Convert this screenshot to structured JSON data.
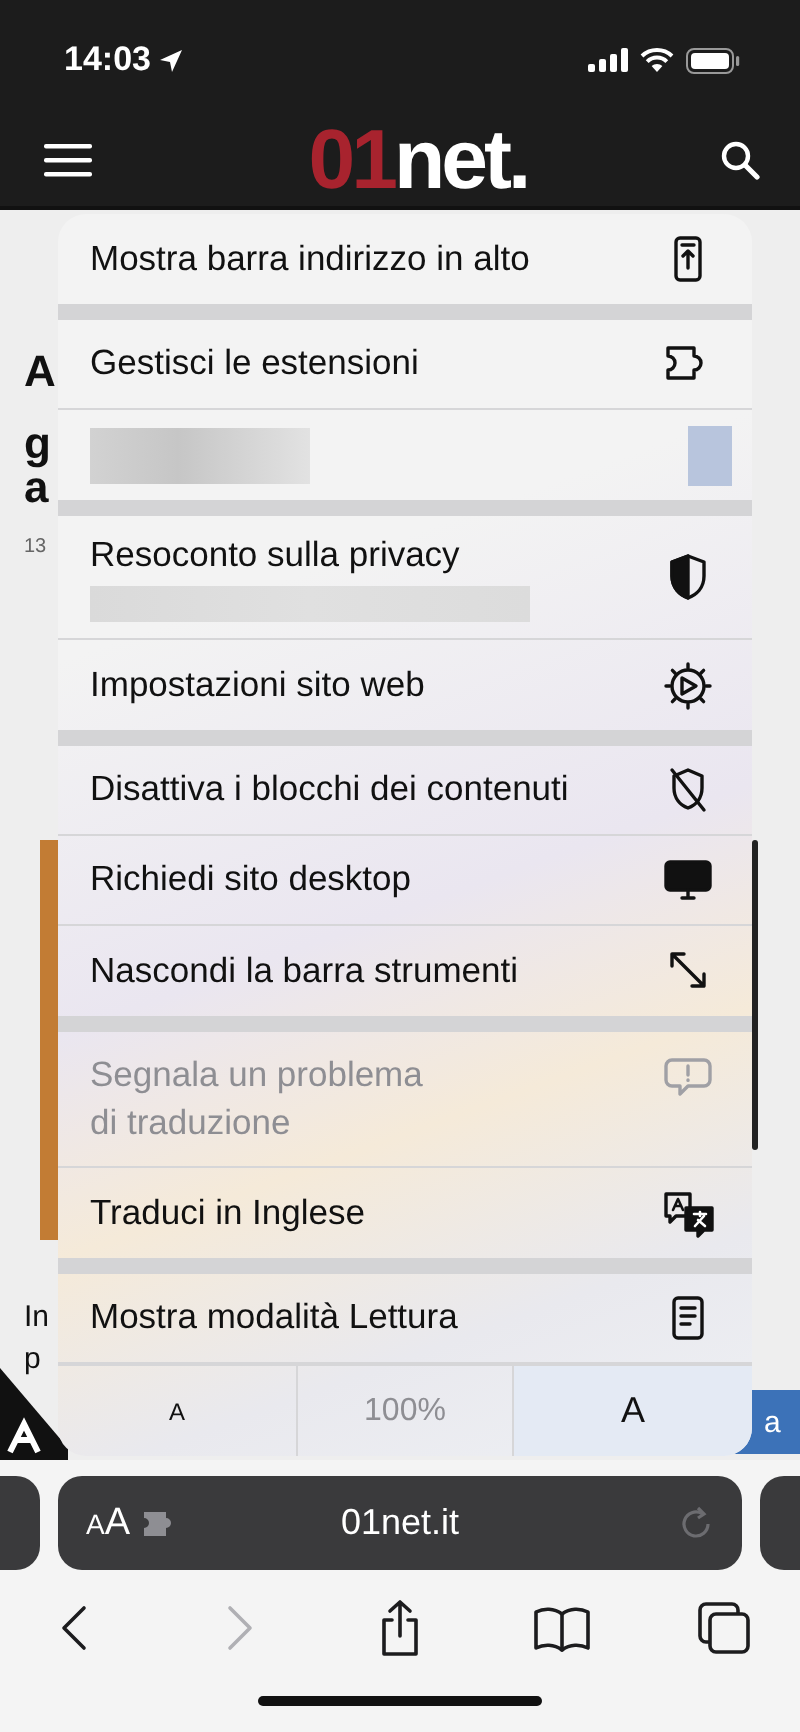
{
  "status_bar": {
    "time": "14:03"
  },
  "header": {
    "logo_red": "01",
    "logo_white": "net."
  },
  "page_behind": {
    "fragments": [
      {
        "kind": "heading",
        "text": "A"
      },
      {
        "kind": "heading",
        "text": "g"
      },
      {
        "kind": "heading",
        "text": "a"
      },
      {
        "kind": "small",
        "text": "13"
      },
      {
        "kind": "body",
        "text": "In"
      },
      {
        "kind": "body",
        "text": "p"
      }
    ],
    "button_text": "a"
  },
  "menu": {
    "items": [
      {
        "kind": "item",
        "label": "Mostra barra indirizzo in alto",
        "disabled": false
      },
      {
        "kind": "separator"
      },
      {
        "kind": "item",
        "label": "Gestisci le estensioni",
        "disabled": false
      },
      {
        "kind": "blurred"
      },
      {
        "kind": "separator"
      },
      {
        "kind": "item_with_hidden_detail",
        "label": "Resoconto sulla privacy",
        "disabled": false
      },
      {
        "kind": "item",
        "label": "Impostazioni sito web",
        "disabled": false
      },
      {
        "kind": "separator"
      },
      {
        "kind": "item",
        "label": "Disattiva i blocchi dei contenuti",
        "disabled": false
      },
      {
        "kind": "item",
        "label": "Richiedi sito desktop",
        "disabled": false
      },
      {
        "kind": "item",
        "label": "Nascondi la barra strumenti",
        "disabled": false
      },
      {
        "kind": "separator"
      },
      {
        "kind": "item",
        "label": "Segnala un problema\ndi traduzione",
        "disabled": true
      },
      {
        "kind": "item",
        "label": "Traduci in Inglese",
        "disabled": false
      },
      {
        "kind": "separator"
      },
      {
        "kind": "item",
        "label": "Mostra modalità Lettura",
        "disabled": false
      }
    ],
    "font_size": {
      "smaller": "A",
      "zoom": "100%",
      "larger": "A"
    }
  },
  "address_bar": {
    "format_small": "A",
    "format_large": "A",
    "url": "01net.it"
  },
  "toolbar": [
    {
      "disabled": false
    },
    {
      "disabled": true
    },
    {
      "disabled": false
    },
    {
      "disabled": false
    },
    {
      "disabled": false
    }
  ]
}
